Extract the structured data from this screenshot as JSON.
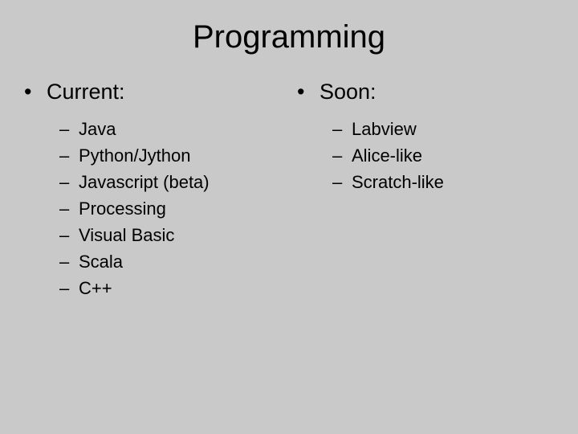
{
  "title": "Programming",
  "left": {
    "heading": "Current:",
    "items": [
      "Java",
      "Python/Jython",
      "Javascript (beta)",
      "Processing",
      "Visual Basic",
      "Scala",
      "C++"
    ]
  },
  "right": {
    "heading": "Soon:",
    "items": [
      "Labview",
      "Alice-like",
      "Scratch-like"
    ]
  },
  "bullet": "•",
  "dash": "–"
}
